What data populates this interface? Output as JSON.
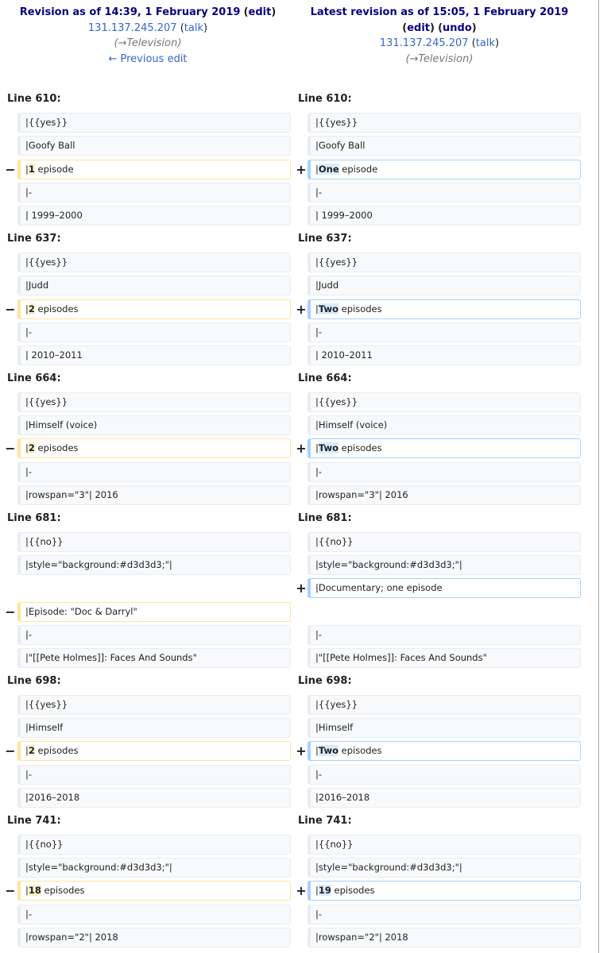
{
  "header": {
    "left": {
      "title": "Revision as of 14:39, 1 February 2019",
      "edit": "edit",
      "user": "131.137.245.207",
      "talk": "talk",
      "comment_arrow": "→",
      "comment_section": "Television",
      "prev": "← Previous edit"
    },
    "right": {
      "title": "Latest revision as of 15:05, 1 February 2019",
      "edit": "edit",
      "undo": "undo",
      "user": "131.137.245.207",
      "talk": "talk",
      "comment_arrow": "→",
      "comment_section": "Television"
    }
  },
  "blocks": [
    {
      "line_left": "Line 610:",
      "line_right": "Line 610:",
      "rows": [
        {
          "type": "ctx",
          "left": "|{{yes}}",
          "right": "|{{yes}}"
        },
        {
          "type": "ctx",
          "left": "|Goofy Ball",
          "right": "|Goofy Ball"
        },
        {
          "type": "chg",
          "left": [
            "|",
            "1",
            " episode"
          ],
          "right": [
            "|",
            "One",
            " episode"
          ]
        },
        {
          "type": "ctx",
          "left": "|-",
          "right": "|-"
        },
        {
          "type": "ctx",
          "left": "| 1999–2000",
          "right": "| 1999–2000"
        }
      ]
    },
    {
      "line_left": "Line 637:",
      "line_right": "Line 637:",
      "rows": [
        {
          "type": "ctx",
          "left": "|{{yes}}",
          "right": "|{{yes}}"
        },
        {
          "type": "ctx",
          "left": "|Judd",
          "right": "|Judd"
        },
        {
          "type": "chg",
          "left": [
            "|",
            "2",
            " episodes"
          ],
          "right": [
            "|",
            "Two",
            " episodes"
          ]
        },
        {
          "type": "ctx",
          "left": "|-",
          "right": "|-"
        },
        {
          "type": "ctx",
          "left": "| 2010–2011",
          "right": "| 2010–2011"
        }
      ]
    },
    {
      "line_left": "Line 664:",
      "line_right": "Line 664:",
      "rows": [
        {
          "type": "ctx",
          "left": "|{{yes}}",
          "right": "|{{yes}}"
        },
        {
          "type": "ctx",
          "left": "|Himself (voice)",
          "right": "|Himself (voice)"
        },
        {
          "type": "chg",
          "left": [
            "|",
            "2",
            " episodes"
          ],
          "right": [
            "|",
            "Two",
            " episodes"
          ]
        },
        {
          "type": "ctx",
          "left": "|-",
          "right": "|-"
        },
        {
          "type": "ctx",
          "left": "|rowspan=\"3\"| 2016",
          "right": "|rowspan=\"3\"| 2016"
        }
      ]
    },
    {
      "line_left": "Line 681:",
      "line_right": "Line 681:",
      "rows": [
        {
          "type": "ctx",
          "left": "|{{no}}",
          "right": "|{{no}}"
        },
        {
          "type": "ctx",
          "left": "|style=\"background:#d3d3d3;\"|",
          "right": "|style=\"background:#d3d3d3;\"|"
        },
        {
          "type": "add",
          "right": "|Documentary; one episode"
        },
        {
          "type": "del",
          "left": "|Episode: \"Doc & Darryl\""
        },
        {
          "type": "ctx",
          "left": "|-",
          "right": "|-"
        },
        {
          "type": "ctx",
          "left": "|\"[[Pete Holmes]]: Faces And Sounds\"",
          "right": "|\"[[Pete Holmes]]: Faces And Sounds\""
        }
      ]
    },
    {
      "line_left": "Line 698:",
      "line_right": "Line 698:",
      "rows": [
        {
          "type": "ctx",
          "left": "|{{yes}}",
          "right": "|{{yes}}"
        },
        {
          "type": "ctx",
          "left": "|Himself",
          "right": "|Himself"
        },
        {
          "type": "chg",
          "left": [
            "|",
            "2",
            " episodes"
          ],
          "right": [
            "|",
            "Two",
            " episodes"
          ]
        },
        {
          "type": "ctx",
          "left": "|-",
          "right": "|-"
        },
        {
          "type": "ctx",
          "left": "|2016–2018",
          "right": "|2016–2018"
        }
      ]
    },
    {
      "line_left": "Line 741:",
      "line_right": "Line 741:",
      "rows": [
        {
          "type": "ctx",
          "left": "|{{no}}",
          "right": "|{{no}}"
        },
        {
          "type": "ctx",
          "left": "|style=\"background:#d3d3d3;\"|",
          "right": "|style=\"background:#d3d3d3;\"|"
        },
        {
          "type": "chg",
          "left": [
            "|",
            "18",
            " episodes"
          ],
          "right": [
            "|",
            "19",
            " episodes"
          ]
        },
        {
          "type": "ctx",
          "left": "|-",
          "right": "|-"
        },
        {
          "type": "ctx",
          "left": "|rowspan=\"2\"| 2018",
          "right": "|rowspan=\"2\"| 2018"
        }
      ]
    }
  ],
  "markers": {
    "minus": "−",
    "plus": "+"
  },
  "colors": {
    "del_border": "#ffe49c",
    "add_border": "#a3d3ff",
    "del_highlight": "#feeec8",
    "add_highlight": "#d8ecff",
    "link": "#3366cc",
    "title": "#0b0080"
  }
}
